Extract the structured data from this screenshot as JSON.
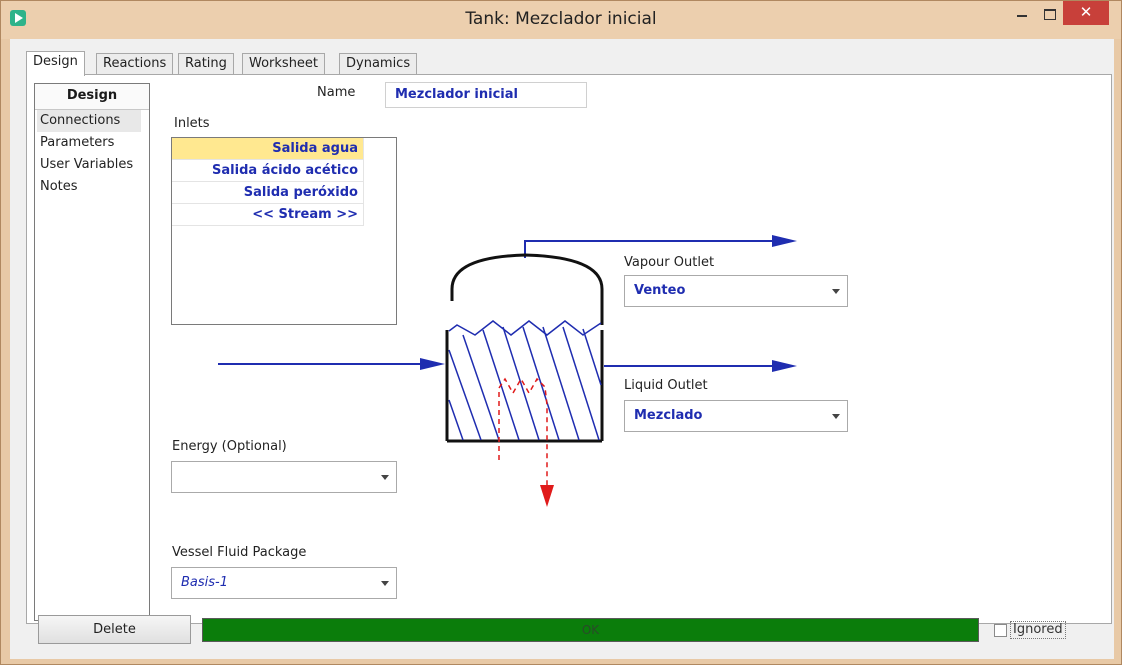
{
  "window": {
    "title": "Tank: Mezclador inicial"
  },
  "tabs": [
    {
      "label": "Design",
      "active": true
    },
    {
      "label": "Reactions",
      "active": false
    },
    {
      "label": "Rating",
      "active": false
    },
    {
      "label": "Worksheet",
      "active": false
    },
    {
      "label": "Dynamics",
      "active": false
    }
  ],
  "nav": {
    "header": "Design",
    "items": [
      {
        "label": "Connections",
        "selected": true
      },
      {
        "label": "Parameters",
        "selected": false
      },
      {
        "label": "User Variables",
        "selected": false
      },
      {
        "label": "Notes",
        "selected": false
      }
    ]
  },
  "name": {
    "label": "Name",
    "value": "Mezclador inicial"
  },
  "inlets": {
    "label": "Inlets",
    "rows": [
      "Salida agua",
      "Salida ácido acético",
      "Salida peróxido",
      "<< Stream >>"
    ]
  },
  "vapour_outlet": {
    "label": "Vapour Outlet",
    "value": "Venteo"
  },
  "liquid_outlet": {
    "label": "Liquid Outlet",
    "value": "Mezclado"
  },
  "energy": {
    "label": "Energy (Optional)",
    "value": ""
  },
  "fluid_package": {
    "label": "Vessel Fluid Package",
    "value": "Basis-1"
  },
  "bottom": {
    "delete_label": "Delete",
    "status_text": "OK",
    "ignored_label": "Ignored",
    "ignored_checked": false
  },
  "colors": {
    "stream_blue": "#1f2db0",
    "energy_red": "#e01a1a",
    "status_green": "#0b7d0b",
    "selected_row": "#ffe890"
  }
}
